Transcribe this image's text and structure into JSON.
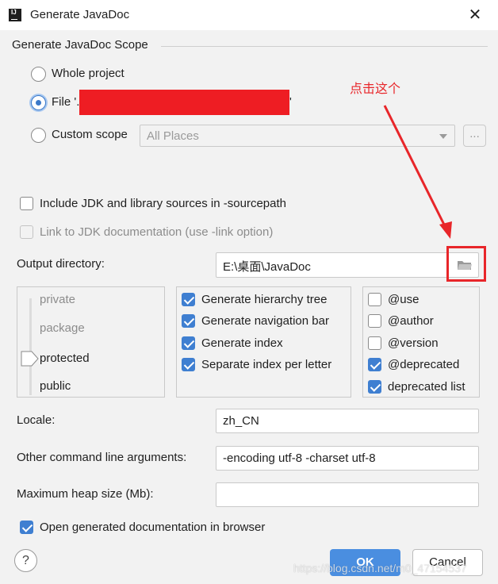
{
  "window": {
    "title": "Generate JavaDoc",
    "app_icon_label": "IJ",
    "close_glyph": "✕"
  },
  "scope": {
    "section_title": "Generate JavaDoc Scope",
    "whole_project": {
      "label": "Whole project",
      "selected": false
    },
    "file": {
      "label_prefix": "File '.",
      "label_suffix": "'",
      "selected": true
    },
    "custom_scope": {
      "label": "Custom scope",
      "selected": false
    },
    "custom_scope_combo": {
      "value": "All Places"
    },
    "ellipsis_label": "..."
  },
  "annotation": {
    "text": "点击这个",
    "color": "#e8262a"
  },
  "options": {
    "include_jdk": {
      "label": "Include JDK and library sources in -sourcepath",
      "checked": false
    },
    "link_jdk": {
      "label": "Link to JDK documentation (use -link option)",
      "checked": false,
      "enabled": false
    }
  },
  "output": {
    "label": "Output directory:",
    "value": "E:\\桌面\\JavaDoc",
    "browse_icon": "folder-icon"
  },
  "visibility": {
    "levels": [
      "private",
      "package",
      "protected",
      "public"
    ],
    "selected": "protected"
  },
  "generate": [
    {
      "label": "Generate hierarchy tree",
      "checked": true
    },
    {
      "label": "Generate navigation bar",
      "checked": true
    },
    {
      "label": "Generate index",
      "checked": true
    },
    {
      "label": "Separate index per letter",
      "checked": true
    }
  ],
  "tags": [
    {
      "label": "@use",
      "checked": false
    },
    {
      "label": "@author",
      "checked": false
    },
    {
      "label": "@version",
      "checked": false
    },
    {
      "label": "@deprecated",
      "checked": true
    },
    {
      "label": "deprecated list",
      "checked": true
    }
  ],
  "locale": {
    "label": "Locale:",
    "value": "zh_CN"
  },
  "other_args": {
    "label": "Other command line arguments:",
    "value": "-encoding utf-8 -charset utf-8"
  },
  "heap": {
    "label": "Maximum heap size (Mb):",
    "value": ""
  },
  "open_browser": {
    "label": "Open generated documentation in browser",
    "checked": true
  },
  "buttons": {
    "ok": "OK",
    "cancel": "Cancel",
    "help": "?"
  },
  "watermark": "https://blog.csdn.net/m0_47154537",
  "colors": {
    "accent": "#3f7fd1",
    "ok_button": "#4a8ee0",
    "redaction": "#ee1d23"
  }
}
